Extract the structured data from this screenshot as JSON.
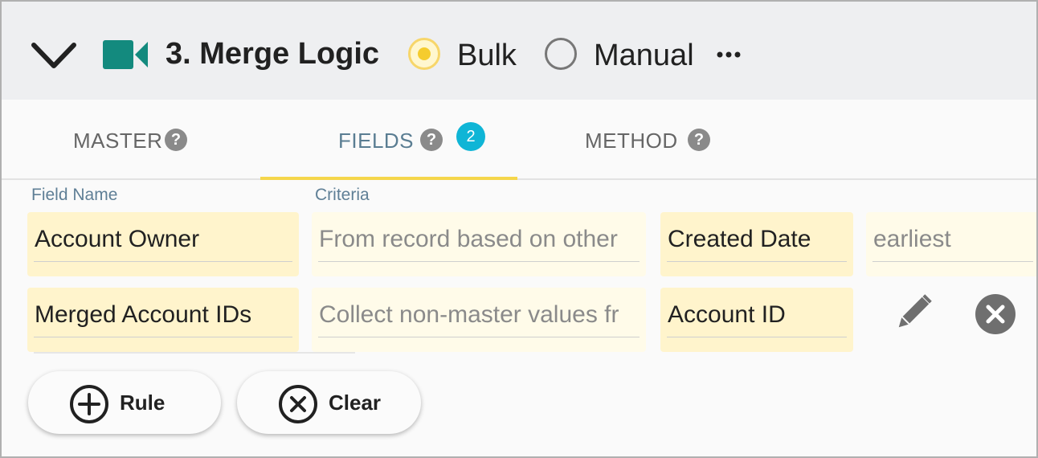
{
  "header": {
    "title": "3. Merge Logic",
    "mode_options": [
      {
        "label": "Bulk",
        "selected": true
      },
      {
        "label": "Manual",
        "selected": false
      }
    ],
    "collapse_icon": "chevron-down-icon",
    "section_icon": "video-camera-icon",
    "more_icon": "more-horizontal-icon"
  },
  "tabs": [
    {
      "label": "MASTER",
      "help": "?",
      "active": false
    },
    {
      "label": "FIELDS",
      "help": "?",
      "badge": "2",
      "active": true
    },
    {
      "label": "METHOD",
      "help": "?",
      "active": false
    }
  ],
  "table": {
    "headers": [
      "Field Name",
      "Criteria"
    ],
    "rows": [
      {
        "field": "Account Owner",
        "criteria": "From record based on other",
        "source": "Created Date",
        "extra": "earliest"
      },
      {
        "field": "Merged Account IDs",
        "criteria": "Collect non-master values fr",
        "source": "Account ID"
      }
    ]
  },
  "row_actions": {
    "edit_icon": "pencil-icon",
    "delete_icon": "close-circle-icon"
  },
  "buttons": {
    "rule": {
      "label": "Rule",
      "icon": "add-circle-icon"
    },
    "clear": {
      "label": "Clear",
      "icon": "close-circle-outline-icon"
    }
  },
  "colors": {
    "accent": "#f5d64b",
    "badge": "#0fb5d6",
    "camera": "#138a7e",
    "cell": "#fff4cc"
  }
}
